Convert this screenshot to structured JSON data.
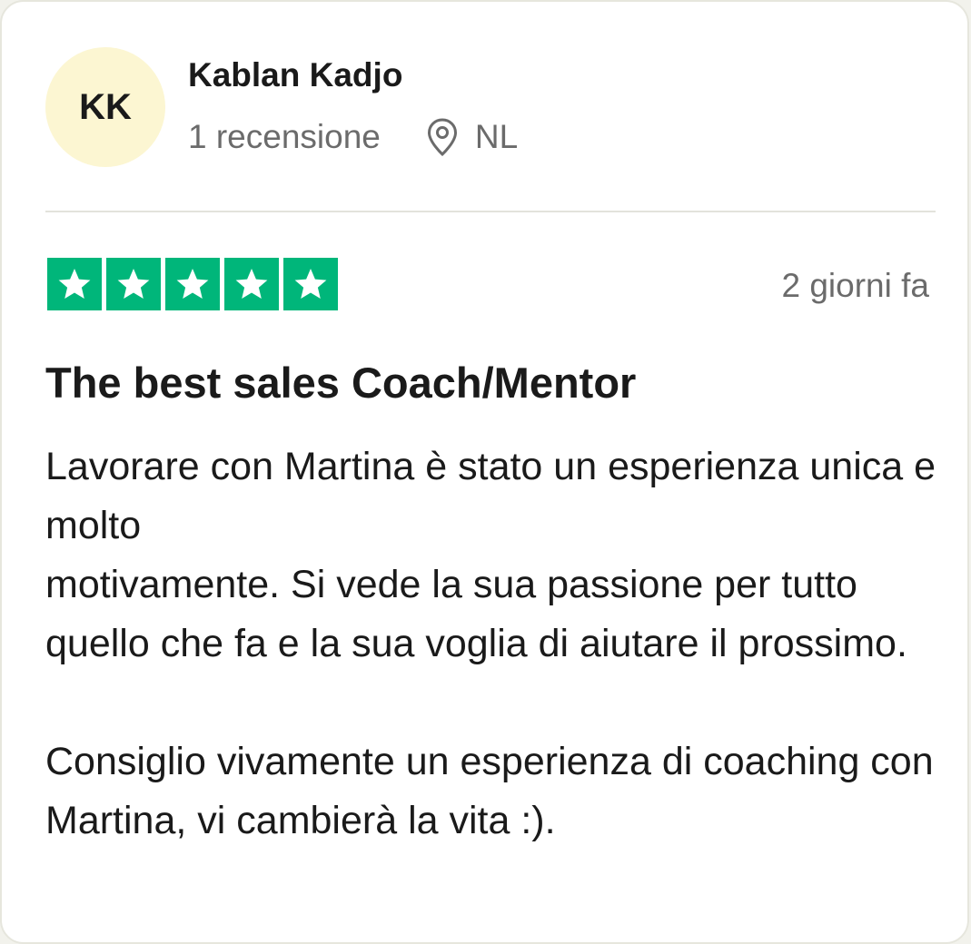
{
  "reviewer": {
    "initials": "KK",
    "name": "Kablan Kadjo",
    "review_count": "1 recensione",
    "country": "NL"
  },
  "review": {
    "rating": 5,
    "rating_max": 5,
    "date": "2 giorni fa",
    "title": "The best sales Coach/Mentor",
    "body_lines": [
      "Lavorare con Martina è stato un esperienza unica e molto",
      "motivamente. Si vede la sua passione per tutto quello che fa e la sua voglia di aiutare il prossimo.",
      "",
      "Consiglio vivamente un esperienza di coaching con Martina, vi cambierà la vita :)."
    ]
  },
  "colors": {
    "star_fill": "#00b67a",
    "avatar_bg": "#fcf6d2",
    "secondary_text": "#6b6b6b"
  },
  "icons": {
    "location": "location-pin-icon",
    "star": "star-icon"
  }
}
